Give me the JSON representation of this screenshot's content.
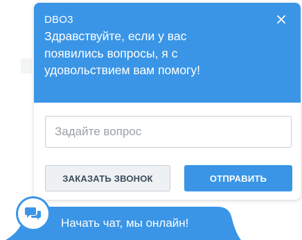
{
  "widget": {
    "operator_name": "DBO3",
    "greeting": "Здравствуйте, если у вас появились вопросы, я с удовольствием вам помогу!",
    "input_placeholder": "Задайте вопрос",
    "input_value": "",
    "call_button_label": "ЗАКАЗАТЬ ЗВОНОК",
    "send_button_label": "ОТПРАВИТЬ"
  },
  "launcher": {
    "label": "Начать чат, мы онлайн!"
  },
  "icons": {
    "close": "close-icon",
    "chat": "chat-bubbles-icon"
  },
  "colors": {
    "accent": "#3a95e6",
    "secondary_button_bg": "#eef1f4",
    "secondary_button_text": "#3b4a59"
  }
}
